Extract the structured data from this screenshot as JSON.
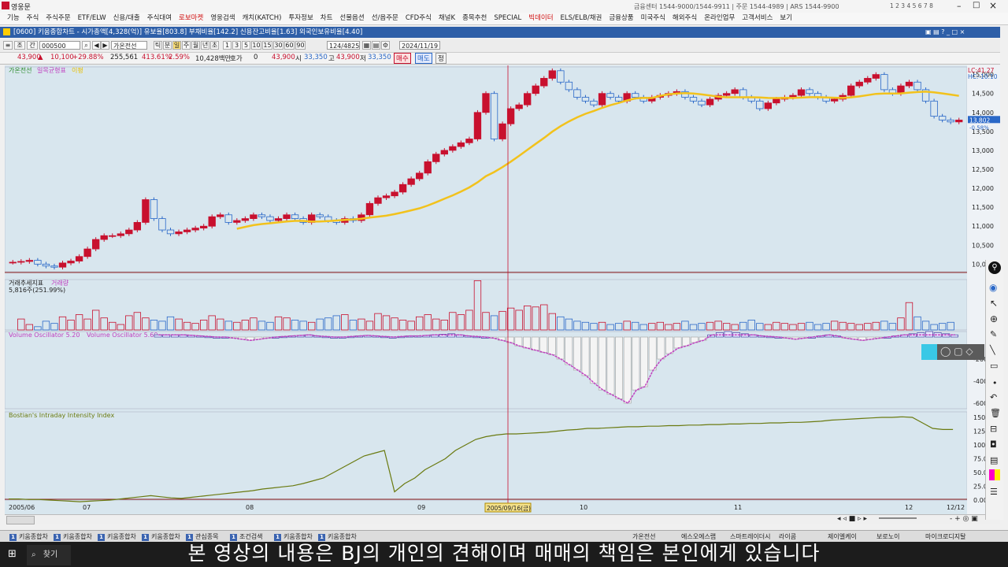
{
  "app": {
    "title": "영웅문",
    "info": "금융센터 1544-9000/1544-9911 | 주문 1544-4989 | ARS 1544-9900",
    "page_nums": [
      "1",
      "2",
      "3",
      "4",
      "5",
      "6",
      "7",
      "8"
    ]
  },
  "menu": [
    "기능",
    "주식",
    "주식주문",
    "ETF/ELW",
    "신용/대출",
    "주식대여",
    "로보마켓",
    "영웅검색",
    "캐치(KATCH)",
    "투자정보",
    "차트",
    "선물옵션",
    "선/옵주문",
    "CFD주식",
    "채널K",
    "종목추천",
    "SPECIAL",
    "빅데이터",
    "ELS/ELB/채권",
    "금융상품",
    "미국주식",
    "해외주식",
    "온라인업무",
    "고객서비스",
    "보기"
  ],
  "menu_red": [
    "로보마켓",
    "빅데이터"
  ],
  "window": {
    "title": "[0600] 키움종합차트 - 시가총액[4,328(억)] 유보율[803.8] 부채비율[142.2] 신용잔고비율[1.63] 외국인보유비율[4.40]"
  },
  "toolbar": {
    "code": "000500",
    "name": "가온전선",
    "periods": [
      "틱",
      "분",
      "일",
      "주",
      "월",
      "년",
      "초"
    ],
    "minutes": [
      "1",
      "3",
      "5",
      "10",
      "15",
      "30",
      "60",
      "90"
    ],
    "count": "124/4825",
    "date": "2024/11/19"
  },
  "quote": {
    "price": "43,900",
    "arrow": "▲",
    "change": "10,100",
    "rate": "+29.88%",
    "volume": "255,561",
    "vol_rate": "413.61%",
    "turnover": "2.59%",
    "amount": "10,428백만",
    "amount_lbl": "호가",
    "zero": "0",
    "cur": "43,900",
    "open_lbl": "시",
    "open": "33,350",
    "high_lbl": "고",
    "high": "43,900",
    "low_lbl": "저",
    "low": "33,350",
    "buy": "매수",
    "sell": "매도"
  },
  "panels": {
    "price_legend": [
      "가온전선",
      "일목균형표",
      "이평"
    ],
    "volume_legend": [
      "거래추세지표",
      "거래량"
    ],
    "volume_text": "5,816주(251.99%)",
    "osc_legend": [
      "Volume Oscillator 5.20",
      "Volume Oscillator 5.60"
    ],
    "bii_legend": "Bostian's Intraday Intensity Index"
  },
  "price_axis": [
    "15,000",
    "14,500",
    "14,000",
    "13,500",
    "13,000",
    "12,500",
    "12,000",
    "11,500",
    "11,000",
    "10,500",
    "10,000"
  ],
  "price_tags": {
    "lc": "LC:41.27",
    "hc": "HC:-10.10",
    "last": "13,802",
    "pct": "-0.58%"
  },
  "osc_axis": [
    "-200",
    "-400",
    "-600"
  ],
  "bii_axis": [
    "150.",
    "125.",
    "100.",
    "75.0",
    "50.0",
    "25.0",
    "0.00"
  ],
  "x_axis": [
    "2005/06",
    "07",
    "08",
    "09",
    "10",
    "11",
    "12",
    "12/12"
  ],
  "cursor_date": "2005/09/16(금)",
  "tabs": [
    "키움종합차",
    "키움종합차",
    "키움종합차",
    "키움종합차",
    "관심종목",
    "조건검색",
    "키움종합차",
    "키움종합차"
  ],
  "bottom_tabs": [
    "가온전선",
    "에스오에스랩",
    "스마트레이더시",
    "라이콤",
    "제이엘케이",
    "보로노이",
    "마이크로디지탈"
  ],
  "search": "찾기",
  "subtitle": "본 영상의 내용은 BJ의 개인의 견해이며 매매의 책임은 본인에게 있습니다",
  "colors": {
    "up": "#c8102e",
    "down": "#2a68c8",
    "ma": "#f2c21c",
    "osc": "#c040c0",
    "bii": "#6a7a10",
    "bg": "#d8e6ee"
  },
  "chart_data": [
    {
      "type": "candlestick",
      "title": "",
      "y_unit": "KRW",
      "ylim": [
        9800,
        15200
      ],
      "closes": [
        10050,
        10070,
        10100,
        10000,
        9950,
        9920,
        10030,
        10080,
        10200,
        10400,
        10650,
        10750,
        10750,
        10800,
        10900,
        11100,
        11700,
        11200,
        10900,
        10800,
        10850,
        10900,
        10950,
        11000,
        11250,
        11300,
        11100,
        11150,
        11200,
        11300,
        11250,
        11150,
        11200,
        11300,
        11200,
        11100,
        11300,
        11250,
        11150,
        11100,
        11200,
        11150,
        11300,
        11600,
        11750,
        11800,
        11900,
        12100,
        12250,
        12400,
        12700,
        12900,
        13000,
        13100,
        13200,
        13300,
        14000,
        14500,
        13300,
        13700,
        14100,
        14200,
        14500,
        14700,
        14900,
        15100,
        14800,
        14600,
        14400,
        14300,
        14200,
        14500,
        14400,
        14300,
        14500,
        14400,
        14300,
        14400,
        14450,
        14500,
        14550,
        14400,
        14300,
        14200,
        14350,
        14450,
        14500,
        14600,
        14400,
        14300,
        14100,
        14250,
        14350,
        14400,
        14450,
        14600,
        14500,
        14400,
        14300,
        14350,
        14450,
        14700,
        14800,
        14900,
        15000,
        14600,
        14500,
        14700,
        14800,
        14600,
        14300,
        13900,
        13800,
        13750,
        13800
      ],
      "ma_start_index": 27
    },
    {
      "type": "bar",
      "title": "",
      "y_unit": "shares",
      "volume_scale": [
        0,
        1,
        0.5,
        0.3,
        0.8,
        0.6,
        1.2,
        0.9,
        1.4,
        1.0,
        1.8,
        1.1,
        0.7,
        0.5,
        1.3,
        1.6,
        1.1,
        0.9,
        0.8,
        1.2,
        1.0,
        0.7,
        0.6,
        0.9,
        1.3,
        1.0,
        0.8,
        0.7,
        0.9,
        1.1,
        0.8,
        0.7,
        1.2,
        1.1,
        0.9,
        0.8,
        0.7,
        1.0,
        1.1,
        1.3,
        1.4,
        0.9,
        1.0,
        0.8,
        1.5,
        1.3,
        1.1,
        0.9,
        0.8,
        1.2,
        1.4,
        1.0,
        0.9,
        1.6,
        1.4,
        1.8,
        4.5,
        1.6,
        1.3,
        1.7,
        2.0,
        1.8,
        2.2,
        2.1,
        2.3,
        1.5,
        1.2,
        1.0,
        0.8,
        0.7,
        0.6,
        0.7,
        0.5,
        0.6,
        0.8,
        0.7,
        0.5,
        0.6,
        0.7,
        0.5,
        0.6,
        0.8,
        0.5,
        0.6,
        0.7,
        0.8,
        0.6,
        0.5,
        0.7,
        0.9,
        0.6,
        0.5,
        0.7,
        0.6,
        0.5,
        0.6,
        0.7,
        0.5,
        0.6,
        0.8,
        0.7,
        0.6,
        0.5,
        0.6,
        0.7,
        0.8,
        0.6,
        1.1,
        2.5,
        1.2,
        0.8,
        0.5,
        0.6,
        0.7
      ]
    },
    {
      "type": "bar",
      "title": "",
      "y_unit": "",
      "ylim": [
        -650,
        50
      ],
      "values": [
        20,
        20,
        20,
        20,
        15,
        10,
        5,
        0,
        0,
        -10,
        -20,
        -30,
        -20,
        -10,
        0,
        5,
        10,
        15,
        20,
        10,
        5,
        0,
        0,
        5,
        10,
        15,
        10,
        5,
        0,
        5,
        10,
        10,
        15,
        20,
        25,
        30,
        20,
        10,
        5,
        0,
        -10,
        -30,
        -50,
        -80,
        -100,
        -120,
        -140,
        -160,
        -200,
        -250,
        -300,
        -350,
        -420,
        -480,
        -520,
        -560,
        -600,
        -480,
        -450,
        -300,
        -200,
        -150,
        -100,
        -80,
        -50,
        -30,
        20,
        40,
        50,
        40,
        30,
        20,
        10,
        5,
        0,
        -10,
        -20,
        -10,
        0,
        10,
        20,
        10,
        -10,
        -20,
        -30,
        -20,
        -10,
        0,
        10,
        20,
        30,
        40,
        50,
        40,
        30,
        20
      ]
    },
    {
      "type": "line",
      "title": "",
      "y_unit": "",
      "ylim": [
        0,
        160
      ],
      "values": [
        2,
        2,
        1,
        1,
        0,
        -1,
        -2,
        -3,
        -2,
        -1,
        0,
        2,
        4,
        6,
        8,
        6,
        4,
        3,
        5,
        7,
        9,
        11,
        13,
        15,
        17,
        20,
        22,
        24,
        26,
        30,
        35,
        40,
        50,
        60,
        70,
        80,
        85,
        90,
        15,
        30,
        40,
        55,
        65,
        75,
        90,
        100,
        110,
        115,
        118,
        120,
        120,
        121,
        122,
        123,
        125,
        127,
        128,
        130,
        130,
        131,
        132,
        133,
        133,
        134,
        134,
        135,
        135,
        136,
        136,
        137,
        137,
        138,
        138,
        139,
        139,
        140,
        140,
        141,
        141,
        142,
        143,
        145,
        146,
        147,
        148,
        149,
        150,
        150,
        151,
        150,
        140,
        130,
        128,
        128
      ]
    }
  ]
}
